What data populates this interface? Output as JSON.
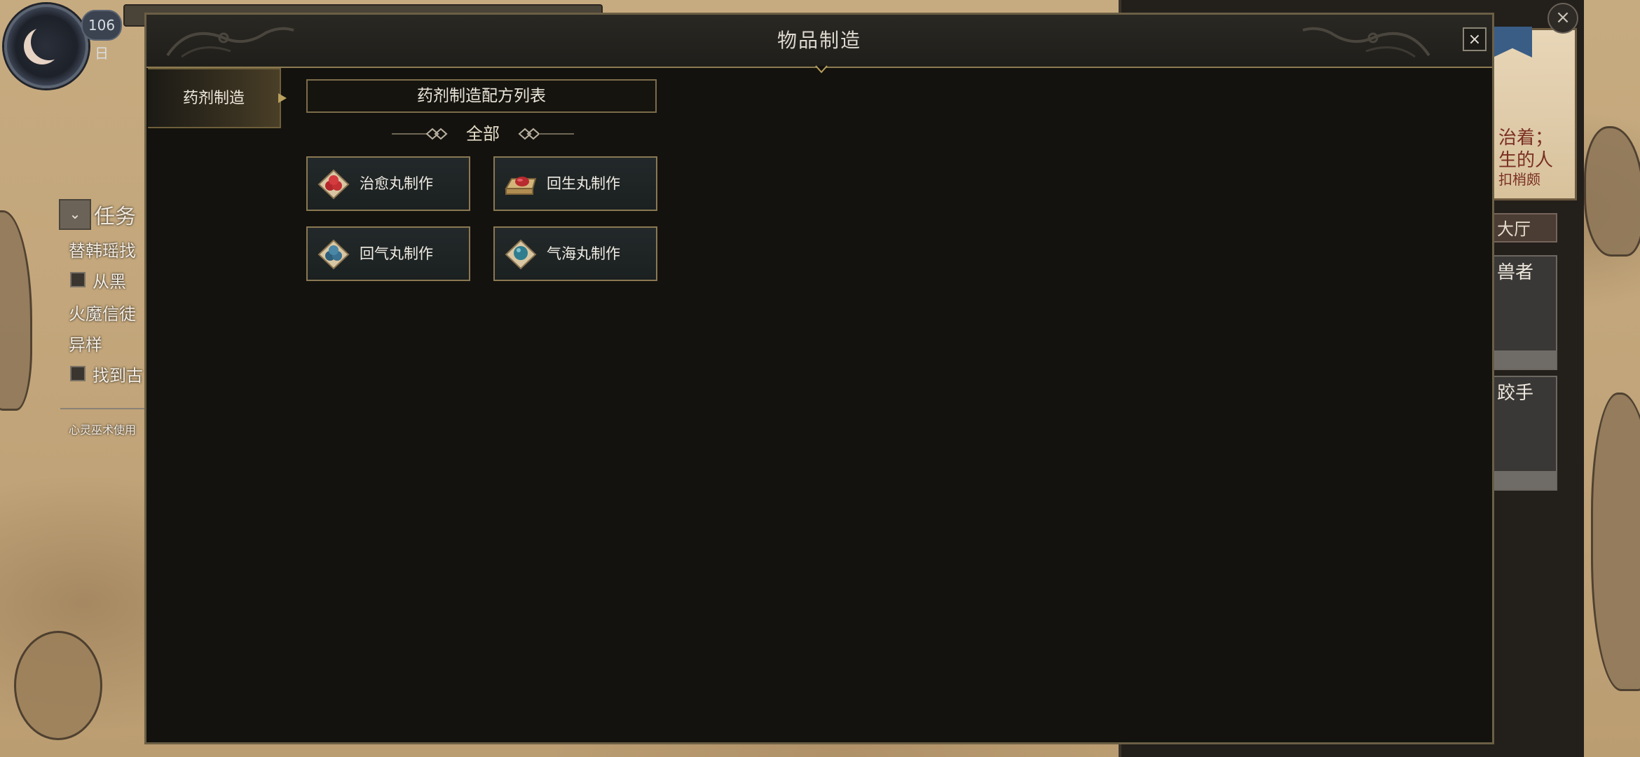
{
  "hud": {
    "day_label": "106日"
  },
  "quest_panel": {
    "title": "任务",
    "lines": [
      "替韩瑶找",
      "火魔信徒",
      "异样"
    ],
    "checkbox_items": [
      "从黑",
      "找到古"
    ],
    "note": "心灵巫术使用"
  },
  "right_panel": {
    "parchment_lines": [
      "治着；",
      "生的人",
      "扣梢颇"
    ],
    "hall_tab": "大厅",
    "cards": [
      "兽者",
      "跤手"
    ]
  },
  "dialog": {
    "title": "物品制造",
    "close_label": "×",
    "tabs": [
      {
        "label": "药剂制造",
        "active": true
      }
    ],
    "recipe_list_header": "药剂制造配方列表",
    "filter": "全部",
    "recipes": [
      {
        "label": "治愈丸制作",
        "icon": "red-pills-icon"
      },
      {
        "label": "回生丸制作",
        "icon": "red-pill-box-icon"
      },
      {
        "label": "回气丸制作",
        "icon": "blue-pills-icon"
      },
      {
        "label": "气海丸制作",
        "icon": "blue-pill-icon"
      }
    ]
  },
  "colors": {
    "dialog_bg": "#13120e",
    "gold_border": "#8a7852",
    "card_bg": "#23292a",
    "text_light": "#f0ece4"
  }
}
